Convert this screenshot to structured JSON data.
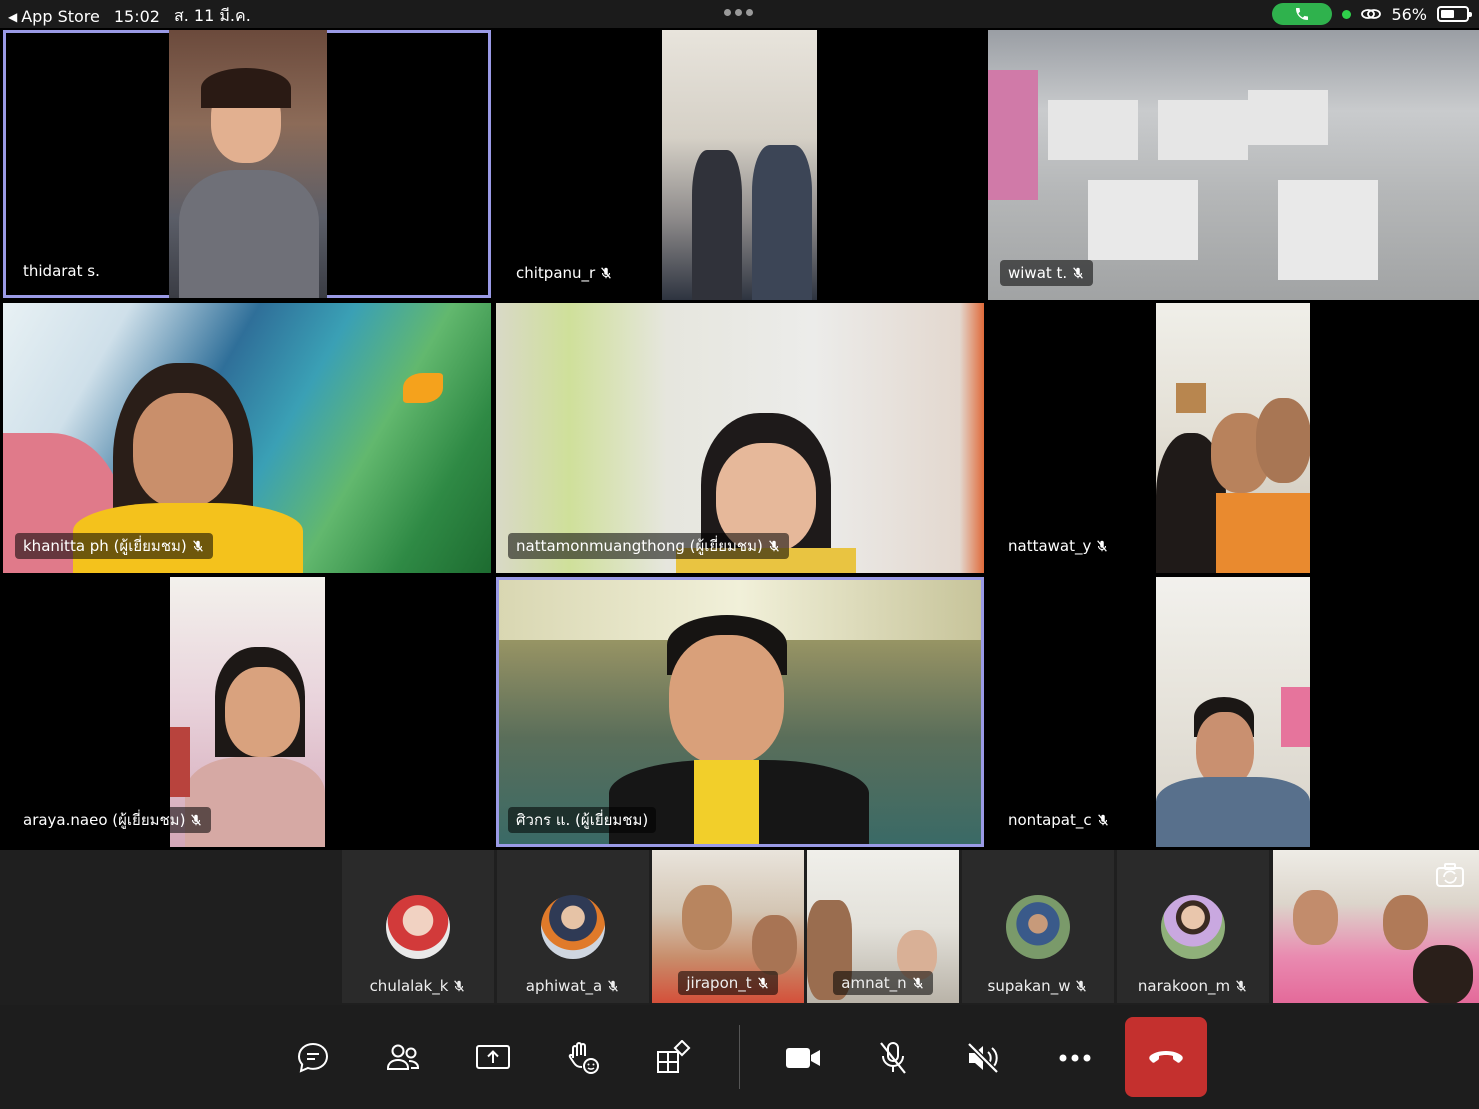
{
  "status_bar": {
    "back_app": "App Store",
    "time": "15:02",
    "date": "ส. 11 มี.ค.",
    "battery_percent": "56%",
    "battery_level": 0.56
  },
  "grid": [
    {
      "name": "thidarat s.",
      "muted": false,
      "active": true
    },
    {
      "name": "chitpanu_r",
      "muted": true,
      "active": false
    },
    {
      "name": "wiwat t.",
      "muted": true,
      "active": false
    },
    {
      "name": "khanitta ph (ผู้เยี่ยมชม)",
      "muted": true,
      "active": false
    },
    {
      "name": "nattamonmuangthong (ผู้เยี่ยมชม)",
      "muted": true,
      "active": false
    },
    {
      "name": "nattawat_y",
      "muted": true,
      "active": false
    },
    {
      "name": "araya.naeo (ผู้เยี่ยมชม)",
      "muted": true,
      "active": false
    },
    {
      "name": "ศิวกร แ. (ผู้เยี่ยมชม)",
      "muted": false,
      "active": true
    },
    {
      "name": "nontapat_c",
      "muted": true,
      "active": false
    }
  ],
  "strip": [
    {
      "name": "chulalak_k",
      "type": "avatar"
    },
    {
      "name": "aphiwat_a",
      "type": "avatar"
    },
    {
      "name": "jirapon_t",
      "type": "video"
    },
    {
      "name": "amnat_n",
      "type": "video"
    },
    {
      "name": "supakan_w",
      "type": "avatar"
    },
    {
      "name": "narakoon_m",
      "type": "avatar"
    }
  ],
  "toolbar": {
    "buttons": [
      "chat-icon",
      "people-icon",
      "share-screen-icon",
      "raise-hand-icon",
      "apps-icon",
      "camera-icon",
      "mic-off-icon",
      "speaker-off-icon",
      "more-icon",
      "hang-up-icon"
    ]
  },
  "colors": {
    "active_border": "#9a9ae6",
    "hangup": "#c4302e",
    "call_pill": "#2fb24d"
  }
}
